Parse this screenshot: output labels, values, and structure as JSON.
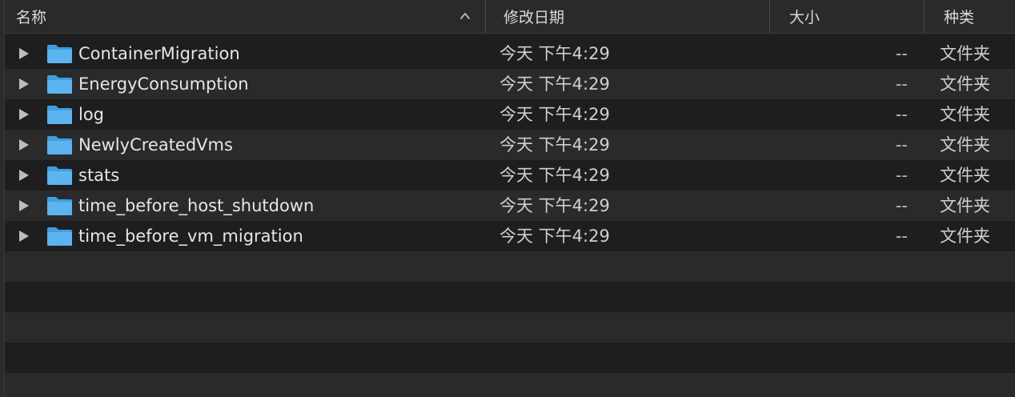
{
  "header": {
    "name_label": "名称",
    "date_label": "修改日期",
    "size_label": "大小",
    "kind_label": "种类",
    "sort_icon": "chevron-up-icon"
  },
  "colors": {
    "folder_blue": "#5bb4f0",
    "folder_blue_dark": "#3f9ee0",
    "background": "#1e1e1e",
    "row_alt": "#2a2a2a"
  },
  "rows": [
    {
      "name": "ContainerMigration",
      "date": "今天 下午4:29",
      "size": "--",
      "kind": "文件夹"
    },
    {
      "name": "EnergyConsumption",
      "date": "今天 下午4:29",
      "size": "--",
      "kind": "文件夹"
    },
    {
      "name": "log",
      "date": "今天 下午4:29",
      "size": "--",
      "kind": "文件夹"
    },
    {
      "name": "NewlyCreatedVms",
      "date": "今天 下午4:29",
      "size": "--",
      "kind": "文件夹"
    },
    {
      "name": "stats",
      "date": "今天 下午4:29",
      "size": "--",
      "kind": "文件夹"
    },
    {
      "name": "time_before_host_shutdown",
      "date": "今天 下午4:29",
      "size": "--",
      "kind": "文件夹"
    },
    {
      "name": "time_before_vm_migration",
      "date": "今天 下午4:29",
      "size": "--",
      "kind": "文件夹"
    }
  ]
}
